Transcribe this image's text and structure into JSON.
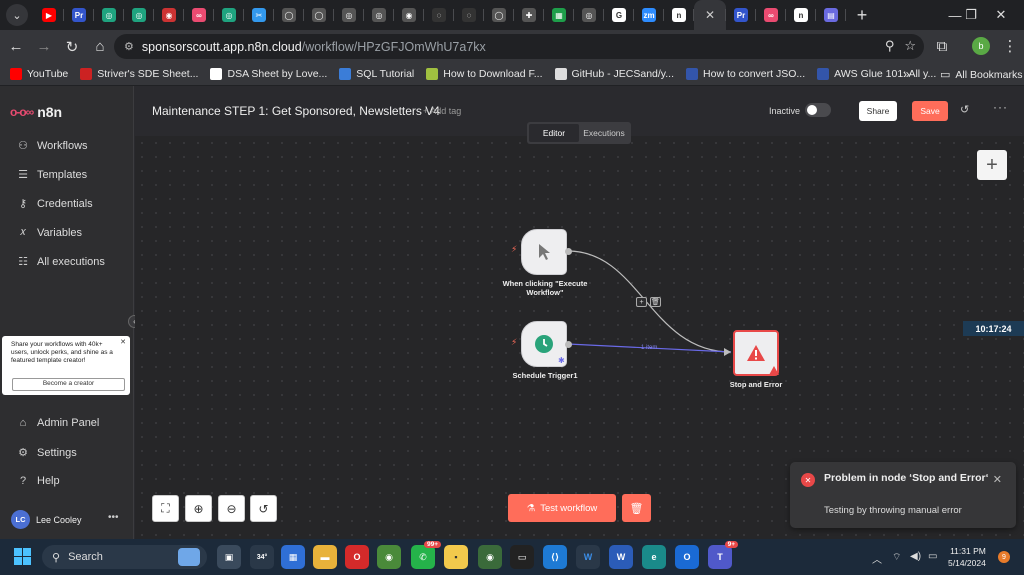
{
  "browser": {
    "tabs": [
      {
        "icon": "youtube-icon",
        "color": "#ff0000",
        "glyph": "▶"
      },
      {
        "icon": "premiere-icon",
        "color": "#3355cc",
        "glyph": "Pr"
      },
      {
        "icon": "chatgpt-icon",
        "color": "#1fa37f",
        "glyph": "◎"
      },
      {
        "icon": "chatgpt-icon",
        "color": "#1fa37f",
        "glyph": "◎"
      },
      {
        "icon": "target-icon",
        "color": "#cc3333",
        "glyph": "◉"
      },
      {
        "icon": "n8n-icon",
        "color": "#ea4b71",
        "glyph": "∞"
      },
      {
        "icon": "chatgpt-icon",
        "color": "#1fa37f",
        "glyph": "◎"
      },
      {
        "icon": "tool-icon",
        "color": "#3399ee",
        "glyph": "✂"
      },
      {
        "icon": "github-icon",
        "color": "#555555",
        "glyph": "◯"
      },
      {
        "icon": "github-icon",
        "color": "#555555",
        "glyph": "◯"
      },
      {
        "icon": "chatgpt-icon",
        "color": "#555555",
        "glyph": "◎"
      },
      {
        "icon": "chatgpt-icon",
        "color": "#555555",
        "glyph": "◎"
      },
      {
        "icon": "chrome-icon",
        "color": "#555555",
        "glyph": "◉"
      },
      {
        "icon": "loading-icon",
        "color": "#333333",
        "glyph": "◌"
      },
      {
        "icon": "loading-icon",
        "color": "#333333",
        "glyph": "◌"
      },
      {
        "icon": "github-icon",
        "color": "#555555",
        "glyph": "◯"
      },
      {
        "icon": "puzzle-icon",
        "color": "#555555",
        "glyph": "✚"
      },
      {
        "icon": "sheets-icon",
        "color": "#1e9e4a",
        "glyph": "▦"
      },
      {
        "icon": "chatgpt-icon",
        "color": "#555555",
        "glyph": "◎"
      },
      {
        "icon": "google-icon",
        "color": "#ffffff",
        "glyph": "G"
      },
      {
        "icon": "zoom-icon",
        "color": "#2d8cff",
        "glyph": "zm"
      },
      {
        "icon": "n8n-icon",
        "color": "#ffffff",
        "glyph": "n"
      }
    ],
    "tabs_after_active": [
      {
        "icon": "premiere-icon",
        "color": "#3355cc",
        "glyph": "Pr"
      },
      {
        "icon": "n8n-icon",
        "color": "#ea4b71",
        "glyph": "∞"
      },
      {
        "icon": "n8n-icon",
        "color": "#ffffff",
        "glyph": "n"
      },
      {
        "icon": "app-icon",
        "color": "#6a6ae0",
        "glyph": "▤"
      }
    ],
    "active_tab_close": "✕",
    "new_tab": "+",
    "url_host": "sponsorscoutt.app.n8n.cloud",
    "url_path": "/workflow/HPzGFJOmWhU7a7kx",
    "profile_initial": "b",
    "bookmarks": [
      {
        "label": "YouTube",
        "color": "#ff0000"
      },
      {
        "label": "Striver's SDE Sheet...",
        "color": "#cc2222"
      },
      {
        "label": "DSA Sheet by Love...",
        "color": "#ffffff"
      },
      {
        "label": "SQL Tutorial",
        "color": "#3b7dd8"
      },
      {
        "label": "How to Download F...",
        "color": "#a0c040"
      },
      {
        "label": "GitHub - JECSand/y...",
        "color": "#dddddd"
      },
      {
        "label": "How to convert JSO...",
        "color": "#3355aa"
      },
      {
        "label": "AWS Glue 101: All y...",
        "color": "#3355aa"
      }
    ],
    "bookmarks_more": "»",
    "all_bookmarks": "All Bookmarks"
  },
  "sidebar": {
    "logo": "n8n",
    "items": [
      {
        "label": "Workflows",
        "icon": "workflows-icon",
        "glyph": "⚇"
      },
      {
        "label": "Templates",
        "icon": "templates-icon",
        "glyph": "☰"
      },
      {
        "label": "Credentials",
        "icon": "key-icon",
        "glyph": "⚷"
      },
      {
        "label": "Variables",
        "icon": "variables-icon",
        "glyph": "𝑥"
      },
      {
        "label": "All executions",
        "icon": "list-icon",
        "glyph": "☷"
      }
    ],
    "promo_text": "Share your workflows with 40k+ users, unlock perks, and shine as a featured template creator!",
    "promo_button": "Become a creator",
    "bottom_items": [
      {
        "label": "Admin Panel",
        "icon": "home-icon",
        "glyph": "⌂"
      },
      {
        "label": "Settings",
        "icon": "gear-icon",
        "glyph": "⚙"
      },
      {
        "label": "Help",
        "icon": "help-icon",
        "glyph": "?"
      }
    ],
    "user_initials": "LC",
    "user_name": "Lee Cooley"
  },
  "header": {
    "workflow_name": "Maintenance STEP 1: Get Sponsored, Newsletters V4",
    "add_tag": "+ Add tag",
    "status_label": "Inactive",
    "active": false,
    "share": "Share",
    "save": "Save",
    "tabs": [
      "Editor",
      "Executions"
    ],
    "active_tab": "Editor"
  },
  "canvas": {
    "nodes": [
      {
        "name": "When clicking \"Execute Workflow\"",
        "icon": "cursor-icon"
      },
      {
        "name": "Schedule Trigger1",
        "icon": "clock-icon"
      },
      {
        "name": "Stop and Error",
        "icon": "warning-icon"
      }
    ],
    "edge_label": "1 item",
    "timer": "10:17:24",
    "test_workflow": "Test workflow",
    "accent": "#ff6d5a"
  },
  "toast": {
    "title": "Problem in node ‘Stop and Error‘",
    "message": "Testing by throwing manual error"
  },
  "taskbar": {
    "search_placeholder": "Search",
    "weather": "34°",
    "whatsapp_badge": "99+",
    "teams_badge": "9+",
    "time": "11:31 PM",
    "date": "5/14/2024",
    "notifications": "9"
  }
}
